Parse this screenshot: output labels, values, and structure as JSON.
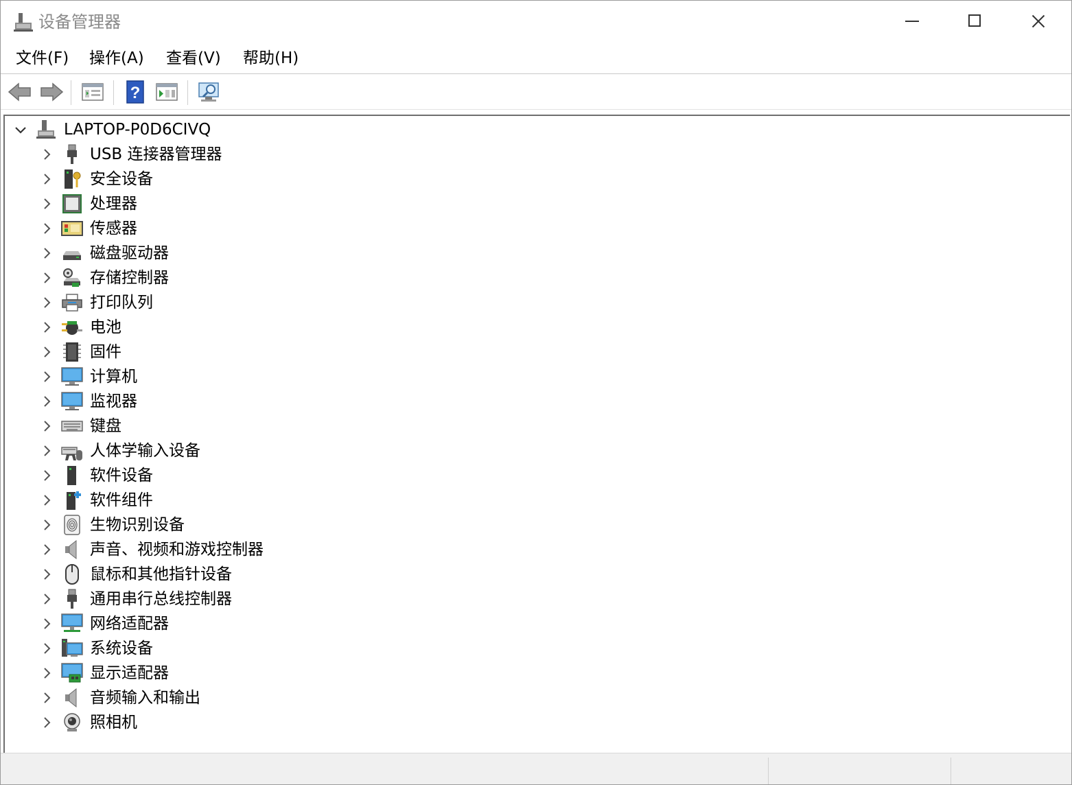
{
  "window": {
    "title": "设备管理器"
  },
  "menu": [
    {
      "label": "文件(F)"
    },
    {
      "label": "操作(A)"
    },
    {
      "label": "查看(V)"
    },
    {
      "label": "帮助(H)"
    }
  ],
  "toolbar": {
    "icons": [
      "back-arrow-icon",
      "forward-arrow-icon",
      "properties-icon",
      "help-icon",
      "update-driver-icon",
      "scan-hardware-icon"
    ]
  },
  "tree": {
    "root": {
      "label": "LAPTOP-P0D6CIVQ",
      "icon": "computer-root-icon",
      "expanded": true
    },
    "items": [
      {
        "label": "USB 连接器管理器",
        "icon": "usb-connector-icon"
      },
      {
        "label": "安全设备",
        "icon": "security-key-icon"
      },
      {
        "label": "处理器",
        "icon": "processor-chip-icon"
      },
      {
        "label": "传感器",
        "icon": "sensor-icon"
      },
      {
        "label": "磁盘驱动器",
        "icon": "disk-drive-icon"
      },
      {
        "label": "存储控制器",
        "icon": "storage-controller-icon"
      },
      {
        "label": "打印队列",
        "icon": "printer-icon"
      },
      {
        "label": "电池",
        "icon": "battery-icon"
      },
      {
        "label": "固件",
        "icon": "firmware-chip-icon"
      },
      {
        "label": "计算机",
        "icon": "computer-monitor-icon"
      },
      {
        "label": "监视器",
        "icon": "monitor-icon"
      },
      {
        "label": "键盘",
        "icon": "keyboard-icon"
      },
      {
        "label": "人体学输入设备",
        "icon": "hid-icon"
      },
      {
        "label": "软件设备",
        "icon": "software-device-icon"
      },
      {
        "label": "软件组件",
        "icon": "software-component-icon"
      },
      {
        "label": "生物识别设备",
        "icon": "fingerprint-icon"
      },
      {
        "label": "声音、视频和游戏控制器",
        "icon": "speaker-icon"
      },
      {
        "label": "鼠标和其他指针设备",
        "icon": "mouse-icon"
      },
      {
        "label": "通用串行总线控制器",
        "icon": "usb-plug-icon"
      },
      {
        "label": "网络适配器",
        "icon": "network-adapter-icon"
      },
      {
        "label": "系统设备",
        "icon": "system-device-icon"
      },
      {
        "label": "显示适配器",
        "icon": "display-adapter-icon"
      },
      {
        "label": "音频输入和输出",
        "icon": "audio-io-icon"
      },
      {
        "label": "照相机",
        "icon": "camera-icon"
      }
    ]
  },
  "colors": {
    "accent_blue": "#2f8fd8",
    "icon_gray": "#505050",
    "green": "#2e9a3a"
  }
}
